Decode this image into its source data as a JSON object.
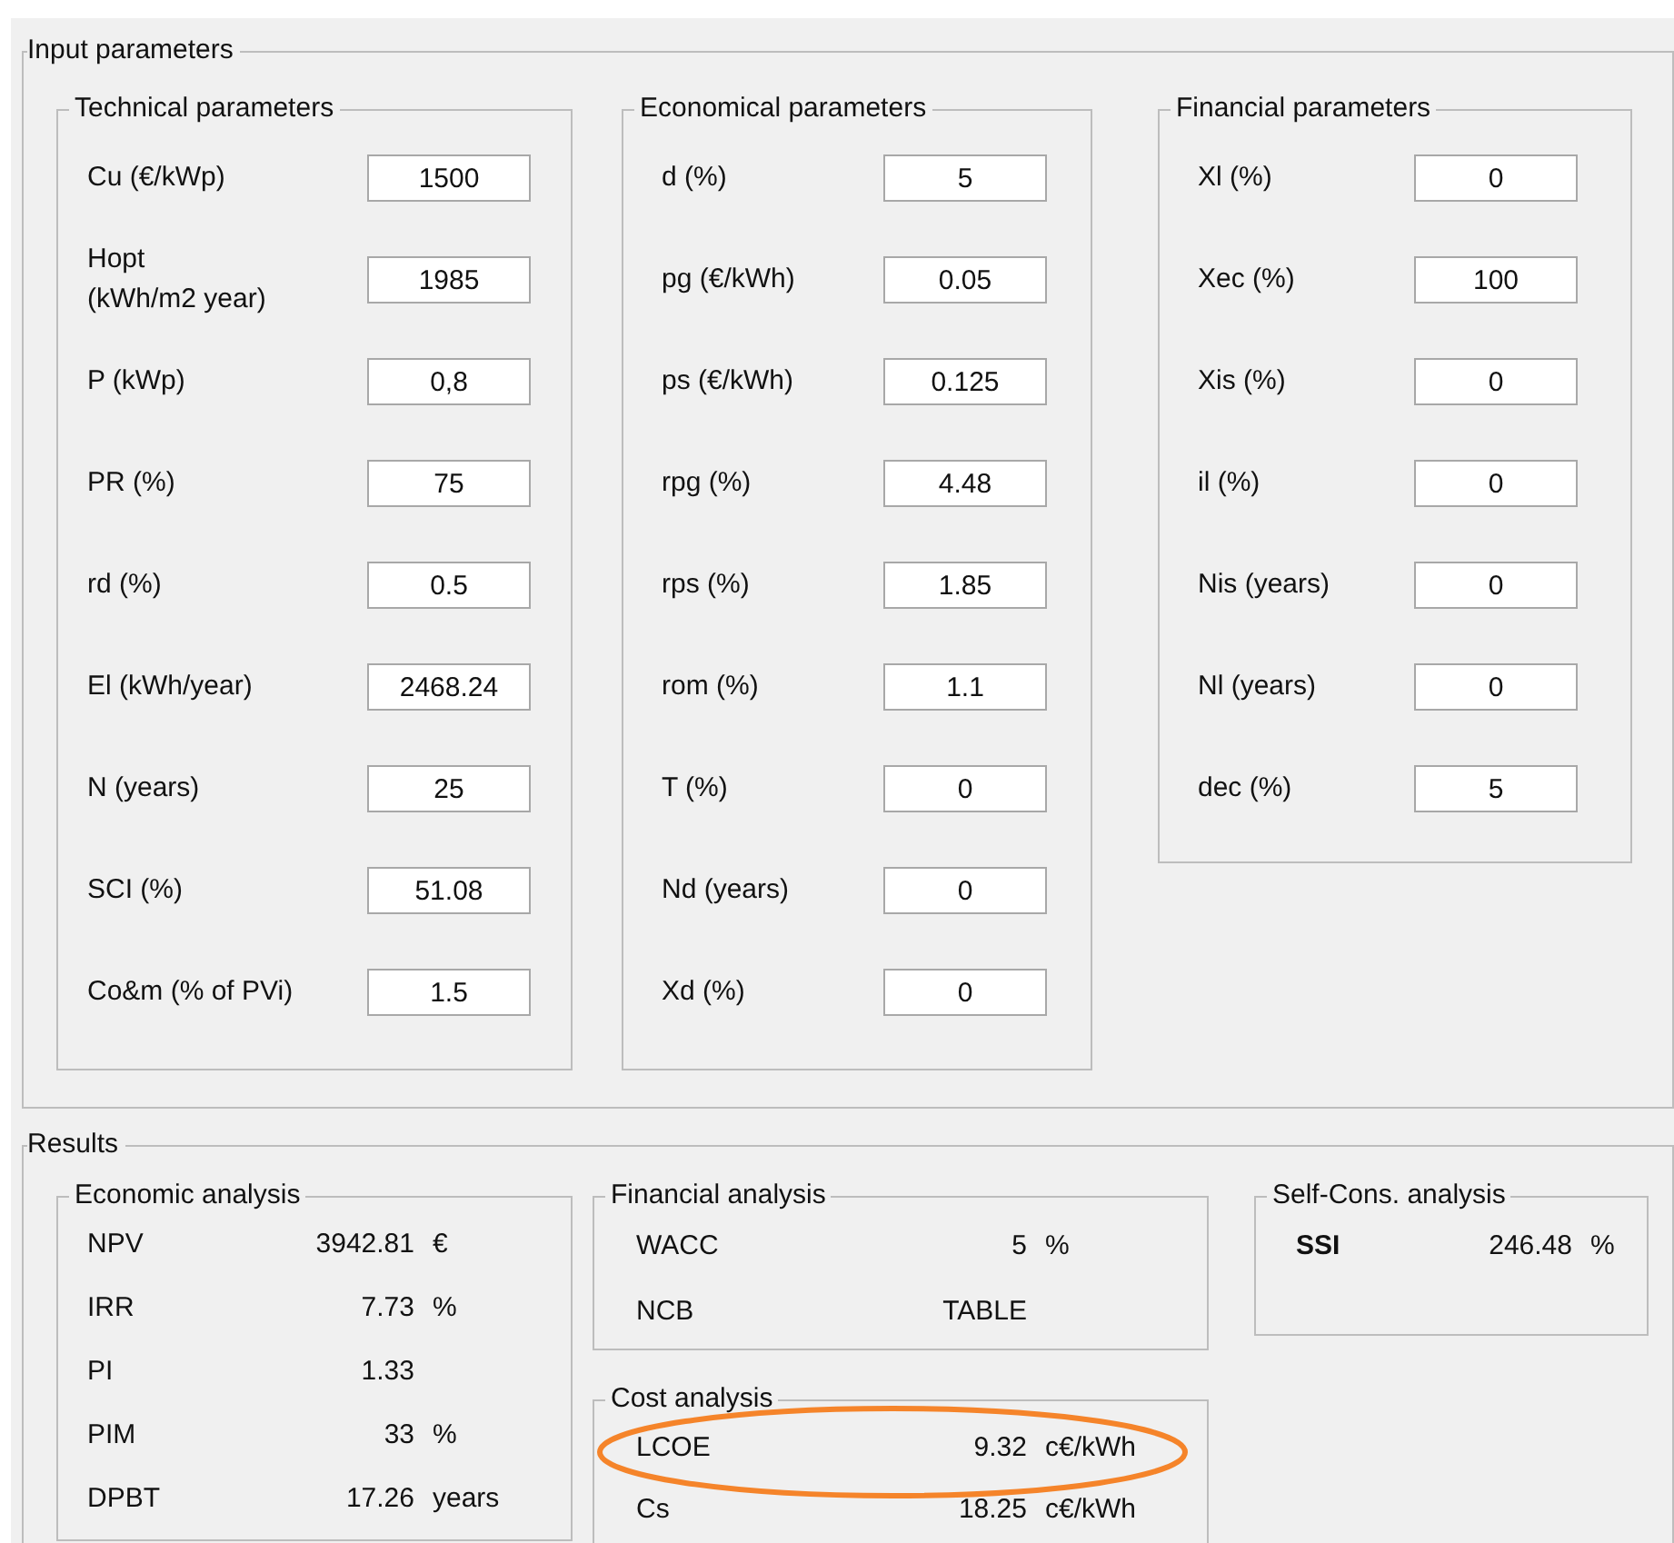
{
  "input_parameters": {
    "title": "Input parameters",
    "groups": [
      {
        "title": "Technical parameters",
        "fields": [
          {
            "label": "Cu (€/kWp)",
            "value": "1500"
          },
          {
            "label": "Hopt\n(kWh/m2 year)",
            "value": "1985"
          },
          {
            "label": "P (kWp)",
            "value": "0,8"
          },
          {
            "label": "PR (%)",
            "value": "75"
          },
          {
            "label": "rd (%)",
            "value": "0.5"
          },
          {
            "label": "El (kWh/year)",
            "value": "2468.24"
          },
          {
            "label": "N (years)",
            "value": "25"
          },
          {
            "label": "SCI (%)",
            "value": "51.08"
          },
          {
            "label": "Co&m (% of PVi)",
            "value": "1.5"
          }
        ]
      },
      {
        "title": "Economical parameters",
        "fields": [
          {
            "label": "d (%)",
            "value": "5"
          },
          {
            "label": "pg (€/kWh)",
            "value": "0.05"
          },
          {
            "label": "ps (€/kWh)",
            "value": "0.125"
          },
          {
            "label": "rpg (%)",
            "value": "4.48"
          },
          {
            "label": "rps (%)",
            "value": "1.85"
          },
          {
            "label": "rom (%)",
            "value": "1.1"
          },
          {
            "label": "T (%)",
            "value": "0"
          },
          {
            "label": "Nd (years)",
            "value": "0"
          },
          {
            "label": "Xd (%)",
            "value": "0"
          }
        ]
      },
      {
        "title": "Financial parameters",
        "fields": [
          {
            "label": "Xl (%)",
            "value": "0"
          },
          {
            "label": "Xec (%)",
            "value": "100"
          },
          {
            "label": "Xis (%)",
            "value": "0"
          },
          {
            "label": "il (%)",
            "value": "0"
          },
          {
            "label": "Nis (years)",
            "value": "0"
          },
          {
            "label": "Nl (years)",
            "value": "0"
          },
          {
            "label": "dec (%)",
            "value": "5"
          }
        ]
      }
    ]
  },
  "results": {
    "title": "Results",
    "groups": [
      {
        "title": "Economic analysis",
        "rows": [
          {
            "label": "NPV",
            "value": "3942.81",
            "unit": "€"
          },
          {
            "label": "IRR",
            "value": "7.73",
            "unit": "%"
          },
          {
            "label": "PI",
            "value": "1.33"
          },
          {
            "label": "PIM",
            "value": "33",
            "unit": "%"
          },
          {
            "label": "DPBT",
            "value": "17.26",
            "unit": "years"
          }
        ]
      },
      {
        "title": "Financial analysis",
        "rows": [
          {
            "label": "WACC",
            "value": "5",
            "unit": "%"
          },
          {
            "label": "NCB",
            "value": "TABLE"
          }
        ]
      },
      {
        "title": "Cost analysis",
        "rows": [
          {
            "label": "LCOE",
            "value": "9.32",
            "unit": "c€/kWh"
          },
          {
            "label": "Cs",
            "value": "18.25",
            "unit": "c€/kWh"
          }
        ]
      },
      {
        "title": "Self-Cons. analysis",
        "rows": [
          {
            "label": "SSI",
            "value": "246.48",
            "unit": "%"
          }
        ]
      }
    ]
  }
}
